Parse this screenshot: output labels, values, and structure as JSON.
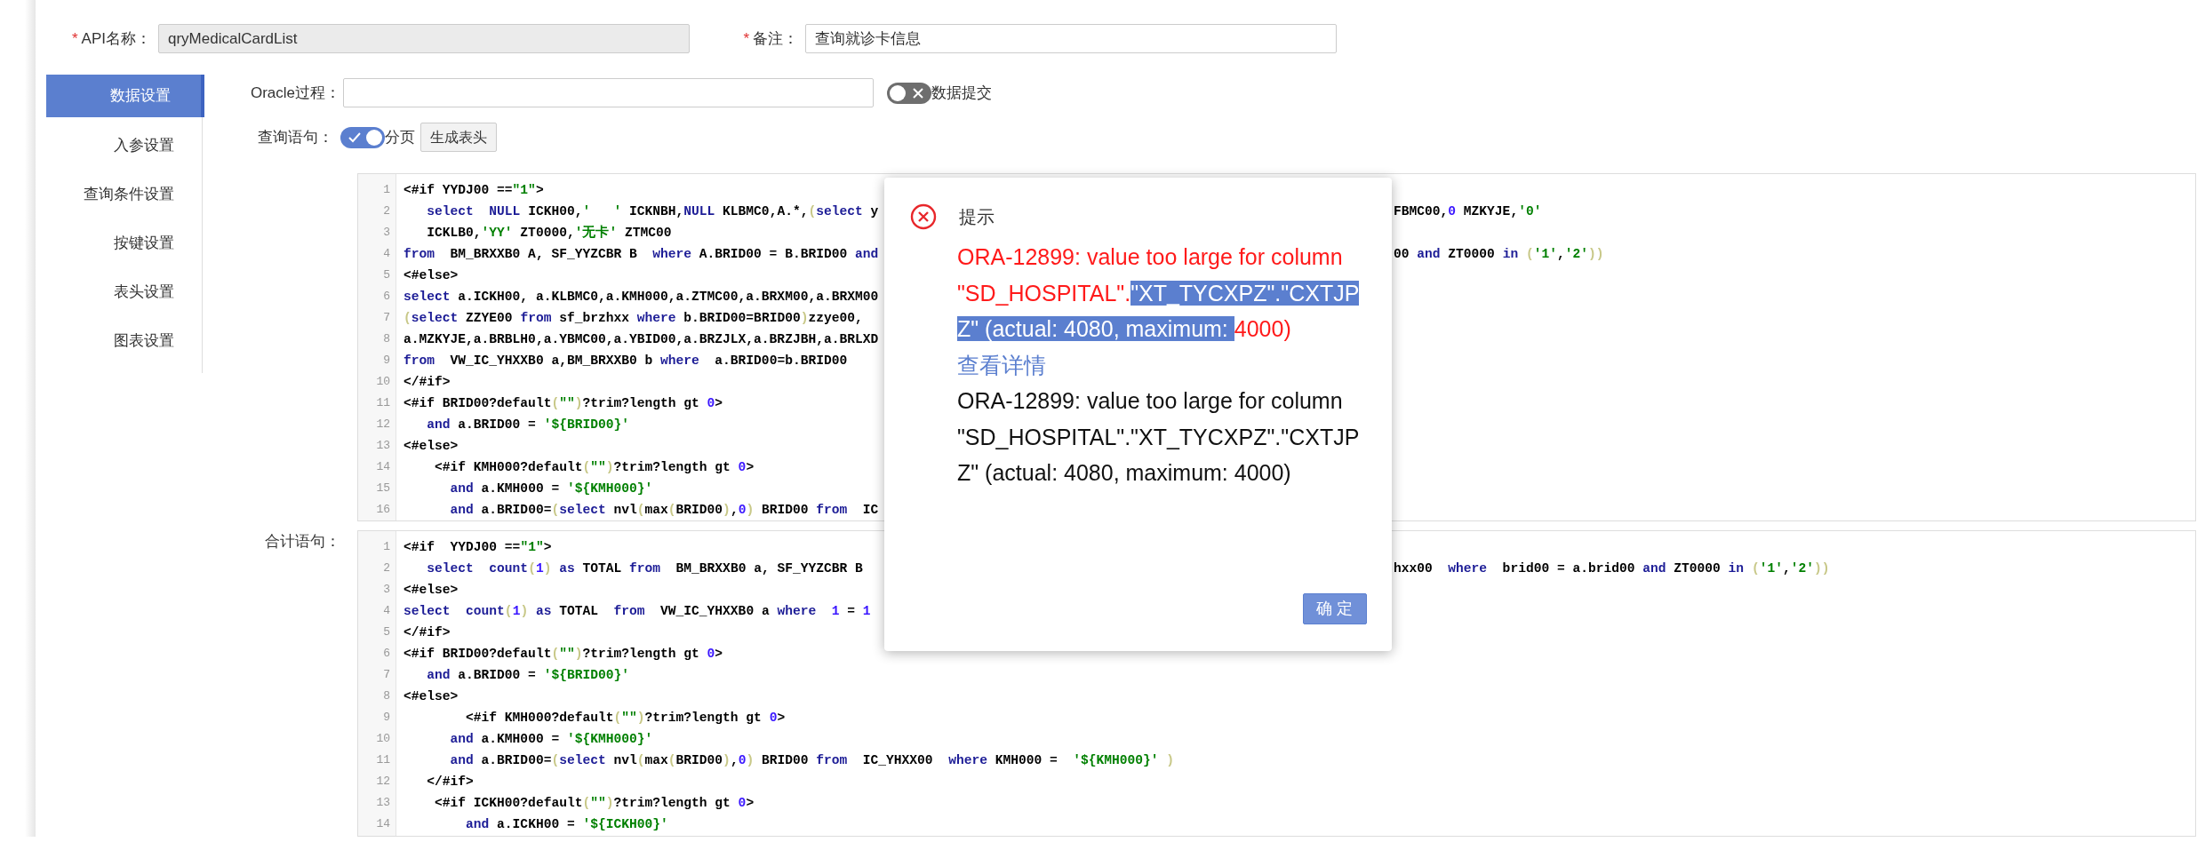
{
  "header_fields": [
    {
      "required_mark": "*",
      "label": "API名称：",
      "value": "qryMedicalCardList",
      "readonly": true
    },
    {
      "required_mark": "*",
      "label": "备注：",
      "value": "查询就诊卡信息",
      "readonly": false
    }
  ],
  "sidebar": {
    "items": [
      {
        "label": "数据设置",
        "selected": true
      },
      {
        "label": "入参设置",
        "selected": false
      },
      {
        "label": "查询条件设置",
        "selected": false
      },
      {
        "label": "按键设置",
        "selected": false
      },
      {
        "label": "表头设置",
        "selected": false
      },
      {
        "label": "图表设置",
        "selected": false
      }
    ]
  },
  "oracle_row": {
    "label": "Oracle过程：",
    "toggle": {
      "label": "数据提交",
      "on": false
    }
  },
  "query_row": {
    "label": "查询语句：",
    "toggle": {
      "label": "分页",
      "on": true
    },
    "button": "生成表头"
  },
  "query_editor": {
    "lines": [
      {
        "no": "1",
        "code": [
          {
            "kind": "t",
            "text": "<#if YYDJ00 =="
          },
          {
            "kind": "s",
            "text": "\"1\""
          },
          {
            "kind": "t",
            "text": ">"
          }
        ]
      },
      {
        "no": "2",
        "code": [
          {
            "kind": "k",
            "text": "   select  "
          },
          {
            "kind": "k",
            "text": "NULL"
          },
          {
            "kind": "t",
            "text": " ICKH00,"
          },
          {
            "kind": "s",
            "text": "'   '"
          },
          {
            "kind": "t",
            "text": " ICKNBH,"
          },
          {
            "kind": "k",
            "text": "NULL"
          },
          {
            "kind": "t",
            "text": " KLBMC0,A.*,"
          },
          {
            "kind": "p",
            "text": "("
          },
          {
            "kind": "k",
            "text": "select"
          },
          {
            "kind": "t",
            "text": " y"
          }
        ],
        "tail": [
          {
            "kind": "t",
            "text": "FBMC00,"
          },
          {
            "kind": "n",
            "text": "0"
          },
          {
            "kind": "t",
            "text": " MZKYJE,"
          },
          {
            "kind": "s",
            "text": "'0'"
          }
        ]
      },
      {
        "no": "3",
        "code": [
          {
            "kind": "t",
            "text": "   ICKLB0,"
          },
          {
            "kind": "s",
            "text": "'YY'"
          },
          {
            "kind": "t",
            "text": " ZT0000,"
          },
          {
            "kind": "s",
            "text": "'无卡'"
          },
          {
            "kind": "t",
            "text": " ZTMC00"
          }
        ]
      },
      {
        "no": "4",
        "code": [
          {
            "kind": "k",
            "text": "from"
          },
          {
            "kind": "t",
            "text": "  BM_BRXXB0 A, SF_YYZCBR B  "
          },
          {
            "kind": "k",
            "text": "where"
          },
          {
            "kind": "t",
            "text": " A.BRID00 = B.BRID00 "
          },
          {
            "kind": "k",
            "text": "and"
          }
        ],
        "tail": [
          {
            "kind": "t",
            "text": "00 "
          },
          {
            "kind": "k",
            "text": "and"
          },
          {
            "kind": "t",
            "text": " ZT0000 "
          },
          {
            "kind": "k",
            "text": "in "
          },
          {
            "kind": "p",
            "text": "("
          },
          {
            "kind": "s",
            "text": "'1'"
          },
          {
            "kind": "t",
            "text": ","
          },
          {
            "kind": "s",
            "text": "'2'"
          },
          {
            "kind": "p",
            "text": "))"
          }
        ]
      },
      {
        "no": "5",
        "code": [
          {
            "kind": "t",
            "text": "<#else>"
          }
        ]
      },
      {
        "no": "6",
        "code": [
          {
            "kind": "k",
            "text": "select"
          },
          {
            "kind": "t",
            "text": " a.ICKH00, a.KLBMC0,a.KMH000,a.ZTMC00,a.BRXM00,a.BRXM00"
          }
        ]
      },
      {
        "no": "7",
        "code": [
          {
            "kind": "p",
            "text": "("
          },
          {
            "kind": "k",
            "text": "select"
          },
          {
            "kind": "t",
            "text": " ZZYE00 "
          },
          {
            "kind": "k",
            "text": "from"
          },
          {
            "kind": "t",
            "text": " sf_brzhxx "
          },
          {
            "kind": "k",
            "text": "where"
          },
          {
            "kind": "t",
            "text": " b.BRID00=BRID00"
          },
          {
            "kind": "p",
            "text": ")"
          },
          {
            "kind": "t",
            "text": "zzye00,"
          }
        ]
      },
      {
        "no": "8",
        "code": [
          {
            "kind": "t",
            "text": "a.MZKYJE,a.BRBLH0,a.YBMC00,a.YBID00,a.BRZJLX,a.BRZJBH,a.BRLXD"
          }
        ]
      },
      {
        "no": "9",
        "code": [
          {
            "kind": "k",
            "text": "from"
          },
          {
            "kind": "t",
            "text": "  VW_IC_YHXXB0 a,BM_BRXXB0 b "
          },
          {
            "kind": "k",
            "text": "where"
          },
          {
            "kind": "t",
            "text": "  a.BRID00=b.BRID00"
          }
        ]
      },
      {
        "no": "10",
        "code": [
          {
            "kind": "t",
            "text": "</#if>"
          }
        ]
      },
      {
        "no": "11",
        "code": [
          {
            "kind": "t",
            "text": "<#if BRID00?default"
          },
          {
            "kind": "p",
            "text": "("
          },
          {
            "kind": "s",
            "text": "\"\""
          },
          {
            "kind": "p",
            "text": ")"
          },
          {
            "kind": "t",
            "text": "?trim?length gt "
          },
          {
            "kind": "n",
            "text": "0"
          },
          {
            "kind": "t",
            "text": ">"
          }
        ]
      },
      {
        "no": "12",
        "code": [
          {
            "kind": "k",
            "text": "   and"
          },
          {
            "kind": "t",
            "text": " a.BRID00 = "
          },
          {
            "kind": "s",
            "text": "'${BRID00}'"
          }
        ]
      },
      {
        "no": "13",
        "code": [
          {
            "kind": "t",
            "text": "<#else>"
          }
        ]
      },
      {
        "no": "14",
        "code": [
          {
            "kind": "t",
            "text": "    <#if KMH000?default"
          },
          {
            "kind": "p",
            "text": "("
          },
          {
            "kind": "s",
            "text": "\"\""
          },
          {
            "kind": "p",
            "text": ")"
          },
          {
            "kind": "t",
            "text": "?trim?length gt "
          },
          {
            "kind": "n",
            "text": "0"
          },
          {
            "kind": "t",
            "text": ">"
          }
        ]
      },
      {
        "no": "15",
        "code": [
          {
            "kind": "k",
            "text": "      and"
          },
          {
            "kind": "t",
            "text": " a.KMH000 = "
          },
          {
            "kind": "s",
            "text": "'${KMH000}'"
          }
        ]
      },
      {
        "no": "16",
        "code": [
          {
            "kind": "k",
            "text": "      and"
          },
          {
            "kind": "t",
            "text": " a.BRID00="
          },
          {
            "kind": "p",
            "text": "("
          },
          {
            "kind": "k",
            "text": "select"
          },
          {
            "kind": "t",
            "text": " nvl"
          },
          {
            "kind": "p",
            "text": "("
          },
          {
            "kind": "t",
            "text": "max"
          },
          {
            "kind": "p",
            "text": "("
          },
          {
            "kind": "t",
            "text": "BRID00"
          },
          {
            "kind": "p",
            "text": ")"
          },
          {
            "kind": "t",
            "text": ","
          },
          {
            "kind": "n",
            "text": "0"
          },
          {
            "kind": "p",
            "text": ")"
          },
          {
            "kind": "t",
            "text": " BRID00 "
          },
          {
            "kind": "k",
            "text": "from"
          },
          {
            "kind": "t",
            "text": "  IC"
          }
        ]
      }
    ]
  },
  "total_row": {
    "label": "合计语句："
  },
  "total_editor": {
    "lines": [
      {
        "no": "1",
        "code": [
          {
            "kind": "t",
            "text": "<#if  YYDJ00 =="
          },
          {
            "kind": "s",
            "text": "\"1\""
          },
          {
            "kind": "t",
            "text": ">"
          }
        ]
      },
      {
        "no": "2",
        "code": [
          {
            "kind": "k",
            "text": "   select  "
          },
          {
            "kind": "k",
            "text": "count"
          },
          {
            "kind": "p",
            "text": "("
          },
          {
            "kind": "n",
            "text": "1"
          },
          {
            "kind": "p",
            "text": ")"
          },
          {
            "kind": "k",
            "text": " as"
          },
          {
            "kind": "t",
            "text": " TOTAL "
          },
          {
            "kind": "k",
            "text": "from"
          },
          {
            "kind": "t",
            "text": "  BM_BRXXB0 a, SF_YYZCBR B"
          }
        ],
        "tail": [
          {
            "kind": "t",
            "text": "hxx00  "
          },
          {
            "kind": "k",
            "text": "where"
          },
          {
            "kind": "t",
            "text": "  brid00 = a.brid00 "
          },
          {
            "kind": "k",
            "text": "and"
          },
          {
            "kind": "t",
            "text": " ZT0000 "
          },
          {
            "kind": "k",
            "text": "in "
          },
          {
            "kind": "p",
            "text": "("
          },
          {
            "kind": "s",
            "text": "'1'"
          },
          {
            "kind": "t",
            "text": ","
          },
          {
            "kind": "s",
            "text": "'2'"
          },
          {
            "kind": "p",
            "text": "))"
          }
        ]
      },
      {
        "no": "3",
        "code": [
          {
            "kind": "t",
            "text": "<#else>"
          }
        ]
      },
      {
        "no": "4",
        "code": [
          {
            "kind": "k",
            "text": "select  "
          },
          {
            "kind": "k",
            "text": "count"
          },
          {
            "kind": "p",
            "text": "("
          },
          {
            "kind": "n",
            "text": "1"
          },
          {
            "kind": "p",
            "text": ")"
          },
          {
            "kind": "k",
            "text": " as"
          },
          {
            "kind": "t",
            "text": " TOTAL  "
          },
          {
            "kind": "k",
            "text": "from"
          },
          {
            "kind": "t",
            "text": "  VW_IC_YHXXB0 a "
          },
          {
            "kind": "k",
            "text": "where  "
          },
          {
            "kind": "n",
            "text": "1"
          },
          {
            "kind": "t",
            "text": " = "
          },
          {
            "kind": "n",
            "text": "1"
          }
        ]
      },
      {
        "no": "5",
        "code": [
          {
            "kind": "t",
            "text": "</#if>"
          }
        ]
      },
      {
        "no": "6",
        "code": [
          {
            "kind": "t",
            "text": "<#if BRID00?default"
          },
          {
            "kind": "p",
            "text": "("
          },
          {
            "kind": "s",
            "text": "\"\""
          },
          {
            "kind": "p",
            "text": ")"
          },
          {
            "kind": "t",
            "text": "?trim?length gt "
          },
          {
            "kind": "n",
            "text": "0"
          },
          {
            "kind": "t",
            "text": ">"
          }
        ]
      },
      {
        "no": "7",
        "code": [
          {
            "kind": "k",
            "text": "   and"
          },
          {
            "kind": "t",
            "text": " a.BRID00 = "
          },
          {
            "kind": "s",
            "text": "'${BRID00}'"
          }
        ]
      },
      {
        "no": "8",
        "code": [
          {
            "kind": "t",
            "text": "<#else>"
          }
        ]
      },
      {
        "no": "9",
        "code": [
          {
            "kind": "t",
            "text": "        <#if KMH000?default"
          },
          {
            "kind": "p",
            "text": "("
          },
          {
            "kind": "s",
            "text": "\"\""
          },
          {
            "kind": "p",
            "text": ")"
          },
          {
            "kind": "t",
            "text": "?trim?length gt "
          },
          {
            "kind": "n",
            "text": "0"
          },
          {
            "kind": "t",
            "text": ">"
          }
        ]
      },
      {
        "no": "10",
        "code": [
          {
            "kind": "k",
            "text": "      and"
          },
          {
            "kind": "t",
            "text": " a.KMH000 = "
          },
          {
            "kind": "s",
            "text": "'${KMH000}'"
          }
        ]
      },
      {
        "no": "11",
        "code": [
          {
            "kind": "k",
            "text": "      and"
          },
          {
            "kind": "t",
            "text": " a.BRID00="
          },
          {
            "kind": "p",
            "text": "("
          },
          {
            "kind": "k",
            "text": "select"
          },
          {
            "kind": "t",
            "text": " nvl"
          },
          {
            "kind": "p",
            "text": "("
          },
          {
            "kind": "t",
            "text": "max"
          },
          {
            "kind": "p",
            "text": "("
          },
          {
            "kind": "t",
            "text": "BRID00"
          },
          {
            "kind": "p",
            "text": ")"
          },
          {
            "kind": "t",
            "text": ","
          },
          {
            "kind": "n",
            "text": "0"
          },
          {
            "kind": "p",
            "text": ")"
          },
          {
            "kind": "t",
            "text": " BRID00 "
          },
          {
            "kind": "k",
            "text": "from"
          },
          {
            "kind": "t",
            "text": "  IC_YHXX00  "
          },
          {
            "kind": "k",
            "text": "where"
          },
          {
            "kind": "t",
            "text": " KMH000 =  "
          },
          {
            "kind": "s",
            "text": "'${KMH000}'"
          },
          {
            "kind": "p",
            "text": " )"
          }
        ]
      },
      {
        "no": "12",
        "code": [
          {
            "kind": "t",
            "text": "   </#if>"
          }
        ]
      },
      {
        "no": "13",
        "code": [
          {
            "kind": "t",
            "text": "    <#if ICKH00?default"
          },
          {
            "kind": "p",
            "text": "("
          },
          {
            "kind": "s",
            "text": "\"\""
          },
          {
            "kind": "p",
            "text": ")"
          },
          {
            "kind": "t",
            "text": "?trim?length gt "
          },
          {
            "kind": "n",
            "text": "0"
          },
          {
            "kind": "t",
            "text": ">"
          }
        ]
      },
      {
        "no": "14",
        "code": [
          {
            "kind": "k",
            "text": "        and"
          },
          {
            "kind": "t",
            "text": " a.ICKH00 = "
          },
          {
            "kind": "s",
            "text": "'${ICKH00}'"
          }
        ]
      }
    ]
  },
  "dialog": {
    "title": "提示",
    "kind": "error",
    "message": [
      {
        "text": "ORA-12899: value too large for column \"SD_HOSPITAL\".",
        "selected": false
      },
      {
        "text": "\"XT_TYCXPZ\".\"CXTJPZ\" (actual: 4080, maximum: ",
        "selected": true
      },
      {
        "text": "4000)",
        "selected": false
      }
    ],
    "details_link": "查看详情",
    "details": "ORA-12899: value too large for column \"SD_HOSPITAL\".\"XT_TYCXPZ\".\"CXTJPZ\" (actual: 4080, maximum: 4000)",
    "button": "确 定"
  }
}
